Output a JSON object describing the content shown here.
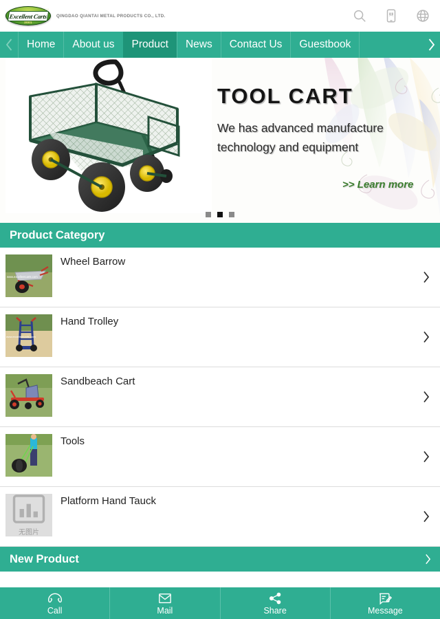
{
  "header": {
    "logo_text": "Excellent Carts",
    "logo_year": "2001",
    "logo_tm": "TM",
    "company_name": "QINGDAO QIANTAI METAL PRODUCTS CO., LTD.",
    "icons": {
      "search": "search-icon",
      "mobile": "mobile-download-icon",
      "language": "globe-icon"
    }
  },
  "nav": {
    "prev_label": "‹",
    "next_label": "›",
    "items": [
      {
        "label": "Home",
        "active": false
      },
      {
        "label": "About us",
        "active": false
      },
      {
        "label": "Product",
        "active": true
      },
      {
        "label": "News",
        "active": false
      },
      {
        "label": "Contact Us",
        "active": false
      },
      {
        "label": "Guestbook",
        "active": false
      }
    ]
  },
  "banner": {
    "title": "TOOL  CART",
    "subtitle_line1": "We has advanced manufacture",
    "subtitle_line2": "technology and equipment",
    "learn_more": ">> Learn more",
    "image_alt": "green-mesh-garden-tool-cart",
    "dots": [
      {
        "active": false
      },
      {
        "active": true
      },
      {
        "active": false
      }
    ]
  },
  "product_category": {
    "title": "Product Category",
    "items": [
      {
        "label": "Wheel Barrow",
        "thumb": "wheelbarrow-photo",
        "has_image": true
      },
      {
        "label": "Hand Trolley",
        "thumb": "hand-trolley-photo",
        "has_image": true
      },
      {
        "label": "Sandbeach Cart",
        "thumb": "sandbeach-cart-photo",
        "has_image": true
      },
      {
        "label": "Tools",
        "thumb": "lawn-roller-photo",
        "has_image": true
      },
      {
        "label": "Platform Hand Tauck",
        "thumb": "no-image-placeholder",
        "has_image": false,
        "placeholder_text": "无图片"
      }
    ]
  },
  "new_product": {
    "title": "New Product"
  },
  "bottom_bar": {
    "items": [
      {
        "label": "Call",
        "icon": "phone-icon"
      },
      {
        "label": "Mail",
        "icon": "envelope-icon"
      },
      {
        "label": "Share",
        "icon": "share-icon"
      },
      {
        "label": "Message",
        "icon": "message-edit-icon"
      }
    ]
  },
  "colors": {
    "teal": "#2FAE92",
    "teal_active": "#1E9478",
    "learn_more_green": "#3b7d2e",
    "icon_gray": "#b8b8b8"
  }
}
